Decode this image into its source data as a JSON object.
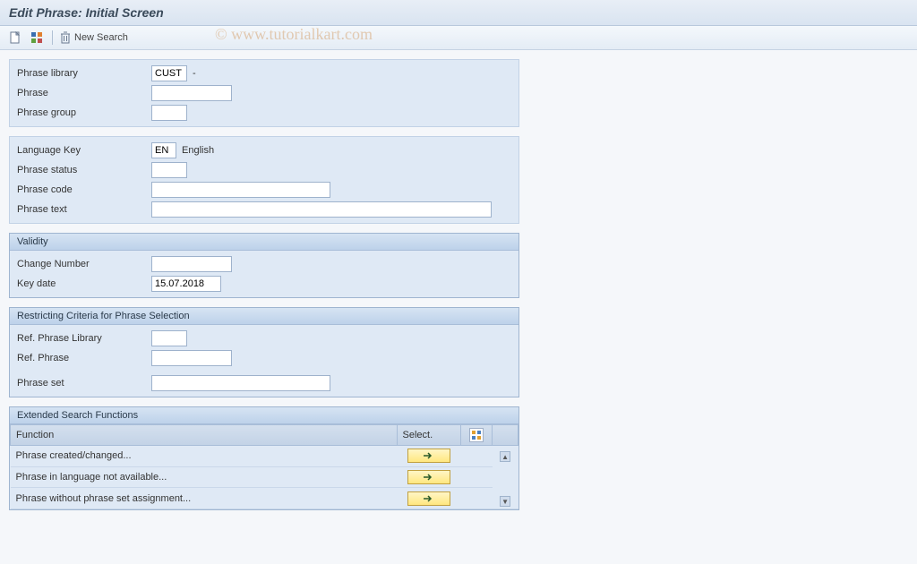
{
  "title": "Edit Phrase: Initial Screen",
  "toolbar": {
    "new_search": "New Search"
  },
  "watermark": "© www.tutorialkart.com",
  "fields": {
    "phrase_library_label": "Phrase library",
    "phrase_library_value": "CUST",
    "phrase_library_after": "-",
    "phrase_label": "Phrase",
    "phrase_value": "",
    "phrase_group_label": "Phrase group",
    "phrase_group_value": "",
    "language_key_label": "Language Key",
    "language_key_value": "EN",
    "language_key_after": "English",
    "phrase_status_label": "Phrase status",
    "phrase_status_value": "",
    "phrase_code_label": "Phrase code",
    "phrase_code_value": "",
    "phrase_text_label": "Phrase text",
    "phrase_text_value": ""
  },
  "validity": {
    "title": "Validity",
    "change_number_label": "Change Number",
    "change_number_value": "",
    "key_date_label": "Key date",
    "key_date_value": "15.07.2018"
  },
  "restricting": {
    "title": "Restricting Criteria for Phrase Selection",
    "ref_phrase_library_label": "Ref. Phrase Library",
    "ref_phrase_library_value": "",
    "ref_phrase_label": "Ref. Phrase",
    "ref_phrase_value": "",
    "phrase_set_label": "Phrase set",
    "phrase_set_value": ""
  },
  "extended": {
    "title": "Extended Search Functions",
    "col_function": "Function",
    "col_select": "Select.",
    "rows": [
      "Phrase created/changed...",
      "Phrase in language not available...",
      "Phrase without phrase set assignment..."
    ]
  }
}
